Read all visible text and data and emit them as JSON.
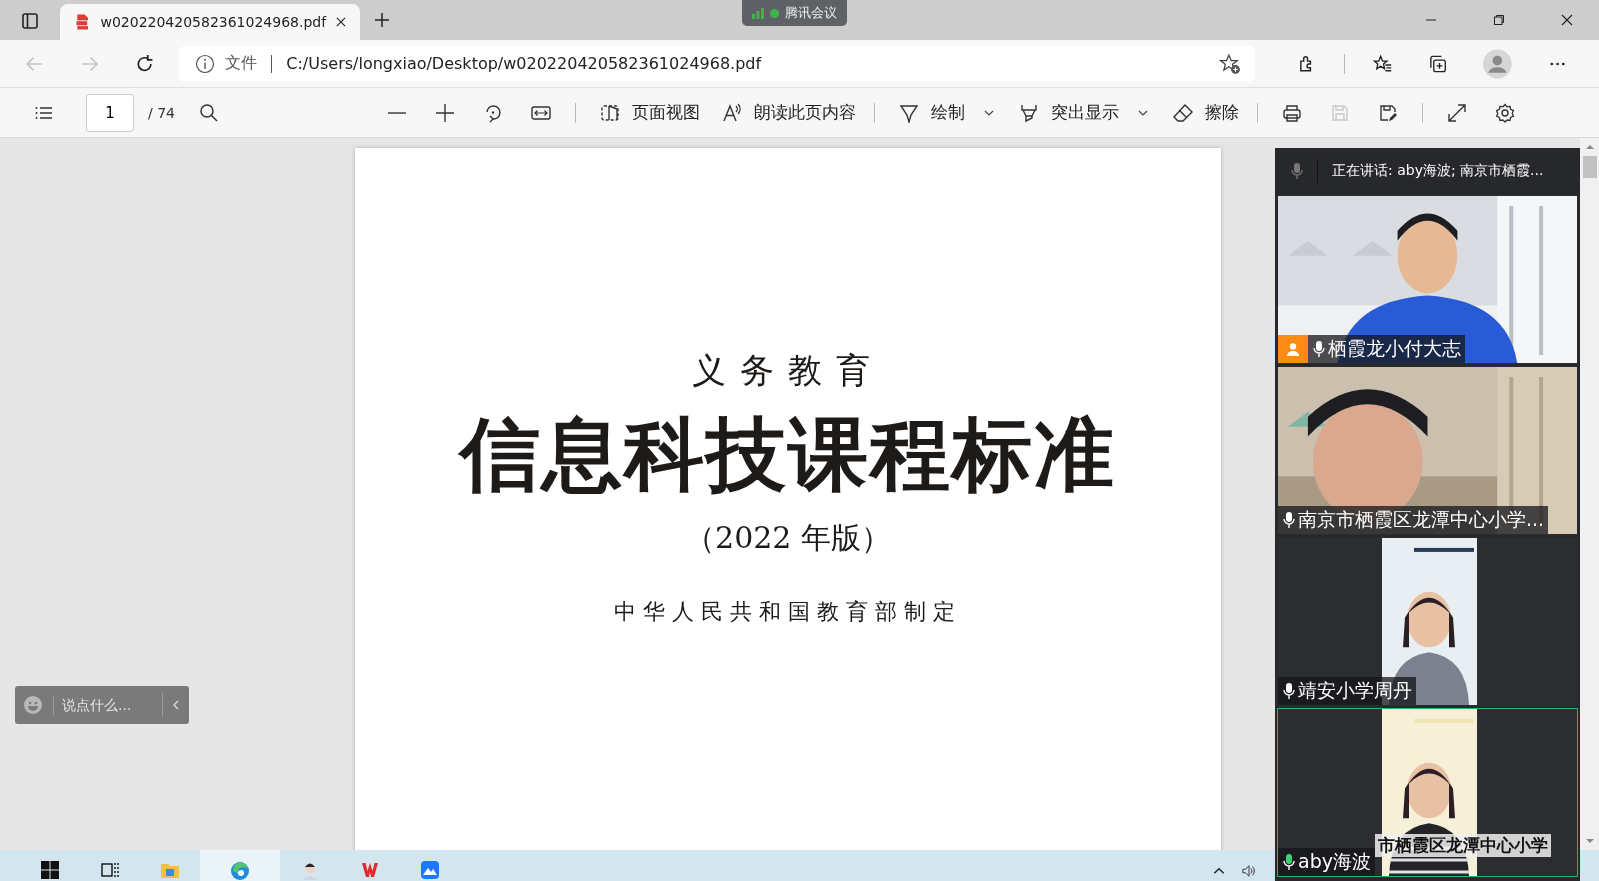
{
  "browser": {
    "tab": {
      "title": "w020220420582361024968.pdf"
    },
    "address": {
      "prefix": "文件",
      "url": "C:/Users/longxiao/Desktop/w020220420582361024968.pdf"
    }
  },
  "meeting_tag": {
    "label": "腾讯会议"
  },
  "pdf_toolbar": {
    "page": "1",
    "total": "/ 74",
    "save_disabled": true,
    "tools": [
      {
        "label": "页面视图",
        "dropdown": false
      },
      {
        "label": "朗读此页内容",
        "dropdown": false
      },
      {
        "label": "绘制",
        "dropdown": true
      },
      {
        "label": "突出显示",
        "dropdown": true
      },
      {
        "label": "擦除",
        "dropdown": false
      }
    ]
  },
  "document": {
    "subtitle": "义务教育",
    "title": "信息科技课程标准",
    "edition": "（2022 年版）",
    "issuer": "中华人民共和国教育部制定"
  },
  "chat": {
    "placeholder": "说点什么..."
  },
  "meeting_panel": {
    "speaking": "正在讲话: aby海波; 南京市栖霞...",
    "tiles": [
      {
        "name": "栖霞龙小付大志",
        "kind": "landscape",
        "host": true,
        "selected": false
      },
      {
        "name": "南京市栖霞区龙潭中心小学...",
        "kind": "landscape",
        "host": false,
        "selected": false
      },
      {
        "name": "靖安小学周丹",
        "kind": "portrait",
        "host": false,
        "selected": false
      },
      {
        "name": "aby海波",
        "kind": "portrait",
        "host": false,
        "selected": true
      }
    ],
    "caption": "市栖霞区龙潭中心小学"
  }
}
